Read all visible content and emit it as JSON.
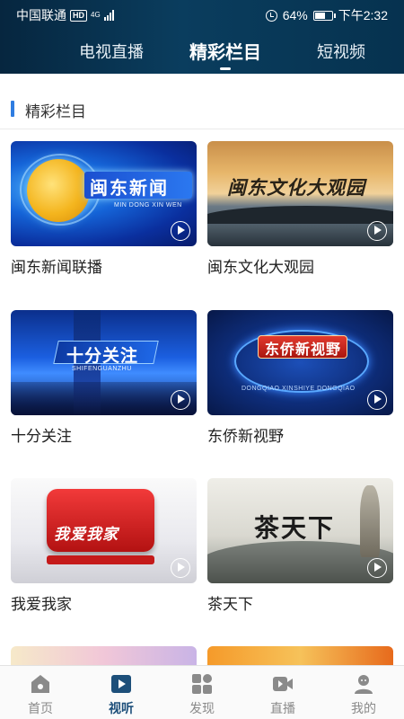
{
  "status_bar": {
    "carrier": "中国联通",
    "hd": "HD",
    "network": "4G",
    "battery": "64%",
    "battery_level": 0.64,
    "time": "下午2:32"
  },
  "top_tabs": [
    {
      "label": "电视直播",
      "active": false
    },
    {
      "label": "精彩栏目",
      "active": true
    },
    {
      "label": "短视频",
      "active": false
    }
  ],
  "section": {
    "title": "精彩栏目",
    "accent_color": "#2f7de1"
  },
  "programs": [
    {
      "title": "闽东新闻联播",
      "thumb_text": "闽东新闻",
      "thumb_sub": "MIN DONG XIN WEN"
    },
    {
      "title": "闽东文化大观园",
      "thumb_text": "闽东文化大观园"
    },
    {
      "title": "十分关注",
      "thumb_text": "十分关注",
      "thumb_sub": "SHIFENGUANZHU"
    },
    {
      "title": "东侨新视野",
      "thumb_text": "东侨新视野",
      "thumb_sub": "DONGQIAO  XINSHIYE  DONGQIAO"
    },
    {
      "title": "我爱我家",
      "thumb_text": "我爱我家"
    },
    {
      "title": "茶天下",
      "thumb_text": "茶天下"
    }
  ],
  "bottom_nav": [
    {
      "label": "首页",
      "icon": "home-icon",
      "active": false
    },
    {
      "label": "视听",
      "icon": "video-play-icon",
      "active": true
    },
    {
      "label": "发现",
      "icon": "discover-grid-icon",
      "active": false
    },
    {
      "label": "直播",
      "icon": "live-camera-icon",
      "active": false
    },
    {
      "label": "我的",
      "icon": "profile-icon",
      "active": false
    }
  ],
  "colors": {
    "header_bg": "#0a3d5e",
    "nav_active": "#1d4f7a",
    "nav_inactive": "#8a8a8a"
  }
}
